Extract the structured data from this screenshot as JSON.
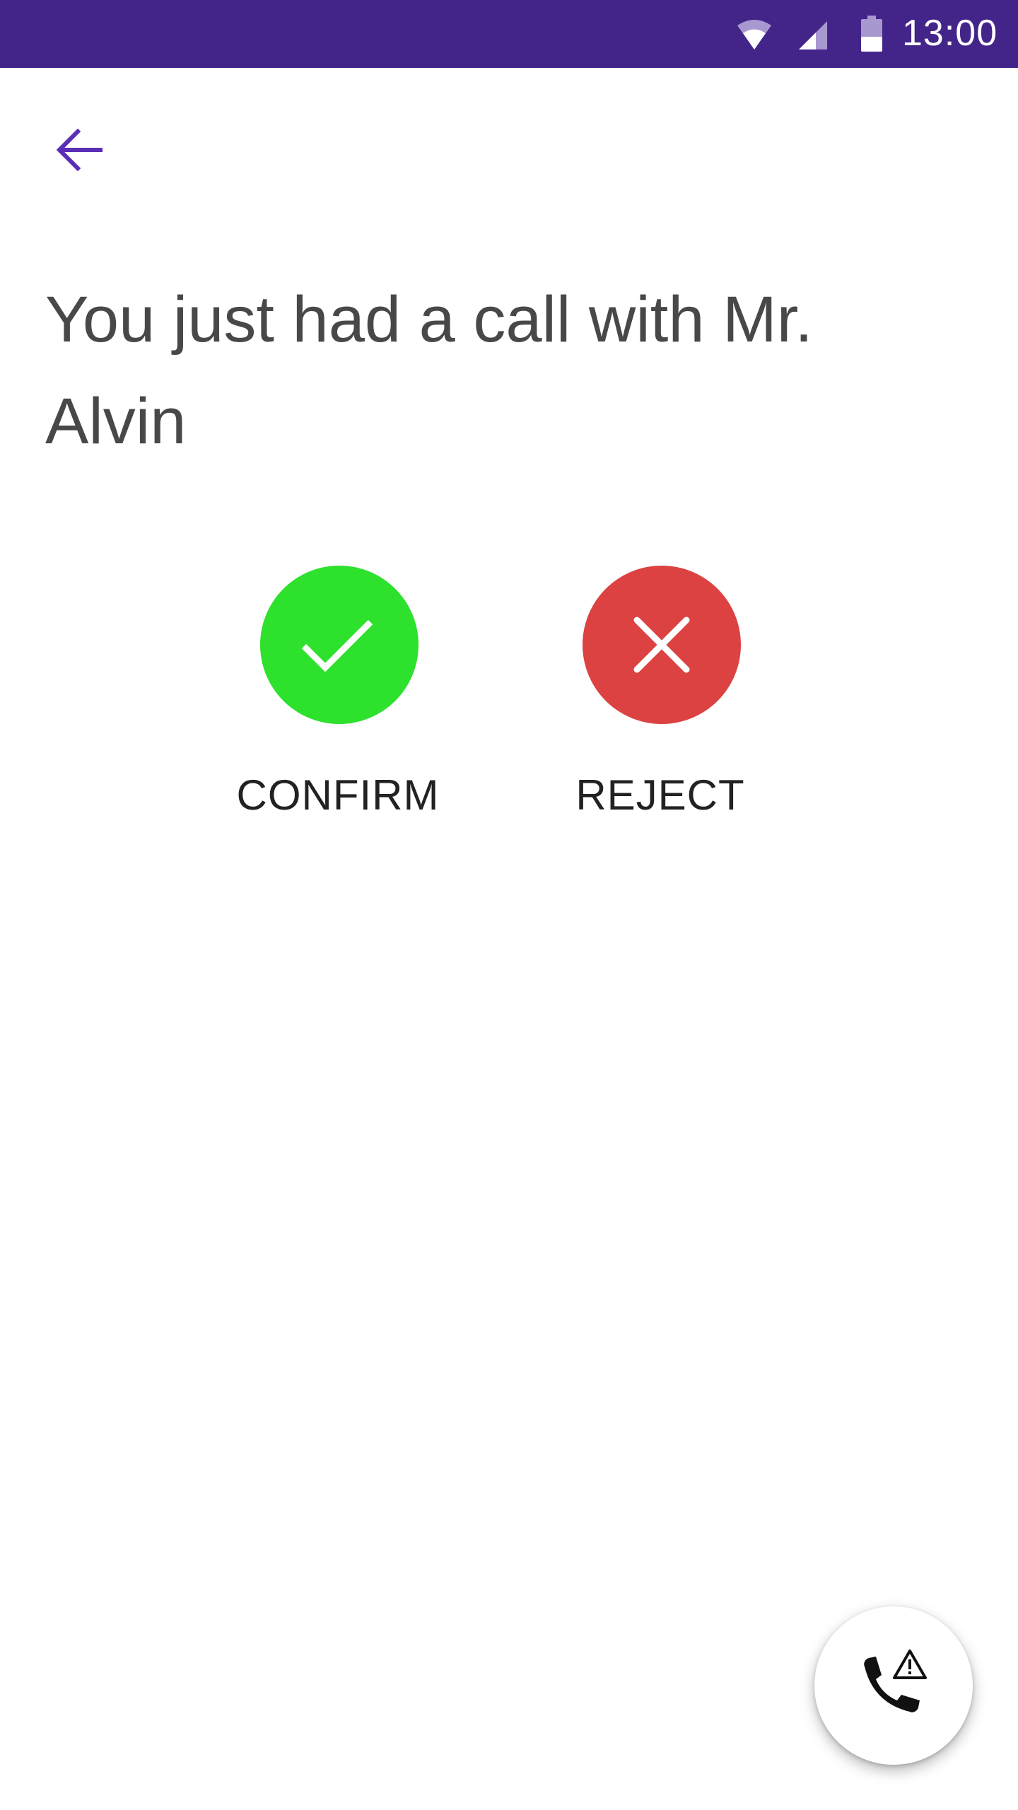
{
  "status_bar": {
    "time": "13:00",
    "background_color": "#432589",
    "icons": [
      "wifi-icon",
      "signal-icon",
      "battery-icon"
    ]
  },
  "navigation": {
    "back_icon": "arrow-left-icon",
    "accent_color": "#5b2fb5"
  },
  "main": {
    "heading": "You just had a call with Mr. Alvin"
  },
  "actions": {
    "confirm": {
      "label": "CONFIRM",
      "icon": "checkmark-icon",
      "color": "#2de12d"
    },
    "reject": {
      "label": "REJECT",
      "icon": "close-icon",
      "color": "#dc4242"
    }
  },
  "fab": {
    "icon": "phone-warning-icon"
  }
}
